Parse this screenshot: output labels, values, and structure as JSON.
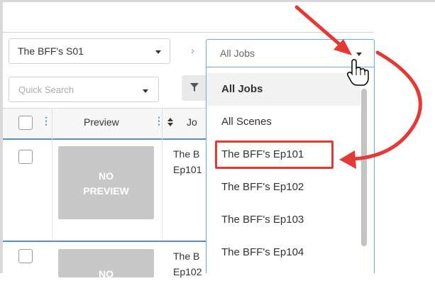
{
  "toolbar": {
    "season_select": {
      "value": "The BFF's S01"
    },
    "breadcrumb_separator": "›",
    "job_select": {
      "value": "All Jobs"
    },
    "quick_search": {
      "placeholder": "Quick Search"
    }
  },
  "grid": {
    "columns": [
      "Preview",
      "Jo"
    ],
    "rows": [
      {
        "preview_text": [
          "NO",
          "PREVIEW"
        ],
        "job_lines": [
          "The B",
          "Ep101"
        ]
      },
      {
        "preview_text": [
          "NO"
        ],
        "job_lines": [
          "The B",
          "Ep102"
        ]
      }
    ]
  },
  "dropdown": {
    "items": [
      {
        "label": "All Jobs",
        "selected": true
      },
      {
        "label": "All Scenes"
      },
      {
        "label": "The BFF's Ep101",
        "highlighted": true
      },
      {
        "label": "The BFF's Ep102"
      },
      {
        "label": "The BFF's Ep103"
      },
      {
        "label": "The BFF's Ep104"
      }
    ]
  },
  "colors": {
    "accent_blue": "#4f90d6",
    "annotation_red": "#e53935",
    "preview_gray": "#c8c8c8",
    "selected_item_bg": "#f2f2f2"
  },
  "icons": [
    "caret-down-icon",
    "chevron-right-icon",
    "filter-icon",
    "sort-icon",
    "hand-cursor-icon",
    "annotation-arrow"
  ]
}
